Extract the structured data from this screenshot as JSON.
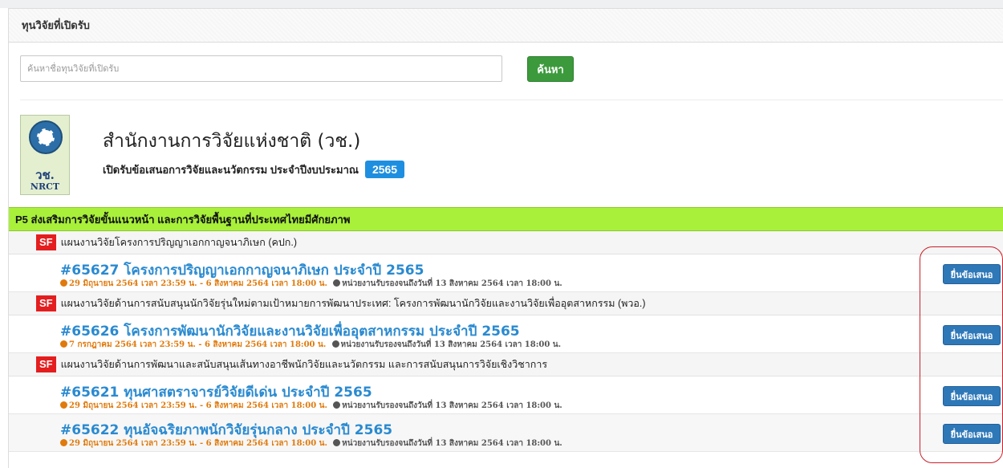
{
  "panel": {
    "title": "ทุนวิจัยที่เปิดรับ"
  },
  "search": {
    "placeholder": "ค้นหาชื่อทุนวิจัยที่เปิดรับ",
    "button_label": "ค้นหา"
  },
  "org": {
    "logo_text_thai": "วช.",
    "logo_text_en": "NRCT",
    "name": "สำนักงานการวิจัยแห่งชาติ (วช.)",
    "subtitle": "เปิดรับข้อเสนอการวิจัยและนวัตกรรม ประจำปีงบประมาณ",
    "year": "2565"
  },
  "program": {
    "title": "P5 ส่งเสริมการวิจัยขั้นแนวหน้า และการวิจัยพื้นฐานที่ประเทศไทยมีศักยภาพ"
  },
  "plans": [
    {
      "badge": "SF",
      "label": "แผนงานวิจัยโครงการปริญญาเอกกาญจนาภิเษก (คปก.)"
    },
    {
      "badge": "SF",
      "label": "แผนงานวิจัยด้านการสนับสนุนนักวิจัยรุ่นใหม่ตามเป้าหมายการพัฒนาประเทศ: โครงการพัฒนานักวิจัยและงานวิจัยเพื่ออุตสาหกรรม (พวอ.)"
    },
    {
      "badge": "SF",
      "label": "แผนงานวิจัยด้านการพัฒนาและสนับสนุนเส้นทางอาชีพนักวิจัยและนวัตกรรม และการสนับสนุนการวิจัยเชิงวิชาการ"
    }
  ],
  "grants": [
    {
      "title": "#65627 โครงการปริญญาเอกกาญจนาภิเษก ประจำปี 2565",
      "period": "29 มิถุนายน 2564 เวลา 23:59 น. - 6 สิงหาคม 2564 เวลา 18:00 น.",
      "deadline": "หน่วยงานรับรองจนถึงวันที่ 13 สิงหาคม 2564 เวลา 18:00 น.",
      "button": "ยื่นข้อเสนอ"
    },
    {
      "title": "#65626 โครงการพัฒนานักวิจัยและงานวิจัยเพื่ออุตสาหกรรม ประจำปี 2565",
      "period": "7 กรกฎาคม 2564 เวลา 23:59 น. - 6 สิงหาคม 2564 เวลา 18:00 น.",
      "deadline": "หน่วยงานรับรองจนถึงวันที่ 13 สิงหาคม 2564 เวลา 18:00 น.",
      "button": "ยื่นข้อเสนอ"
    },
    {
      "title": "#65621 ทุนศาสตราจารย์วิจัยดีเด่น ประจำปี 2565",
      "period": "29 มิถุนายน 2564 เวลา 23:59 น. - 6 สิงหาคม 2564 เวลา 18:00 น.",
      "deadline": "หน่วยงานรับรองจนถึงวันที่ 13 สิงหาคม 2564 เวลา 18:00 น.",
      "button": "ยื่นข้อเสนอ"
    },
    {
      "title": "#65622 ทุนอัจฉริยภาพนักวิจัยรุ่นกลาง ประจำปี 2565",
      "period": "29 มิถุนายน 2564 เวลา 23:59 น. - 6 สิงหาคม 2564 เวลา 18:00 น.",
      "deadline": "หน่วยงานรับรองจนถึงวันที่ 13 สิงหาคม 2564 เวลา 18:00 น.",
      "button": "ยื่นข้อเสนอ"
    }
  ],
  "colors": {
    "program_bg": "#a8f03a",
    "title_blue": "#2a8ad0",
    "meta_orange": "#e07a0c",
    "button_blue": "#2e78b8",
    "search_green": "#3c9a3c",
    "badge_red": "#e41e1e",
    "highlight_red": "#c8202a"
  }
}
